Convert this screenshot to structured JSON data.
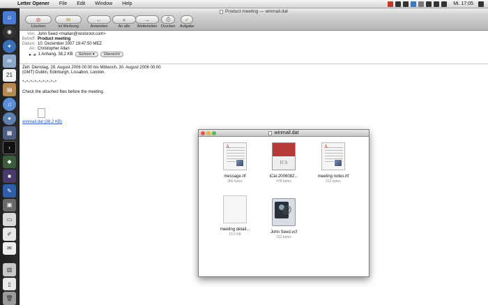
{
  "menubar": {
    "apple": "",
    "app": "Letter Opener",
    "items": [
      "File",
      "Edit",
      "Window",
      "Help"
    ],
    "clock": "Mi. 17:05"
  },
  "mail": {
    "title": "Product meeting — winmail.dat",
    "toolbar": {
      "delete": "Löschen",
      "junk": "Ist Werbung",
      "reply": "Antworten",
      "reply_all": "An alle",
      "forward": "Weiterleiten",
      "print": "Drucken",
      "task": "Aufgabe"
    },
    "headers": {
      "from_label": "Von:",
      "from": "John Seed <mallan@restoroot.com>",
      "subject_label": "Betreff:",
      "subject": "Product meeting",
      "date_label": "Datum:",
      "date": "10. Dezember 2007 19:47:50 MEZ",
      "to_label": "An:",
      "to": "Christopher Allan",
      "attachments": "1 Anhang, 38,2 KB",
      "save_button": "Sichern",
      "overview_button": "Übersicht"
    },
    "body": {
      "line1": "Zeit: Dienstag, 29. August 2006 00:00 bis Mittwoch, 30. August 2006 00:00",
      "line2": "(GMT) Dublin, Edinburgh, Lissabon, London.",
      "line3": "*~*~*~*~*~*~*~*~*",
      "line4": "Check the attached files before the meeting."
    },
    "attachment_link": "winmail.dat (38.2 KB)"
  },
  "finder": {
    "title": "winmail.dat",
    "files": [
      {
        "name": "message.rtf",
        "size": "386 bytes"
      },
      {
        "name": "iCal-2006082...",
        "size": "478 bytes"
      },
      {
        "name": "meeting notes.rtf",
        "size": "231 bytes"
      },
      {
        "name": "meeting detail...",
        "size": "19.0 KB"
      },
      {
        "name": "John Seed.vcf",
        "size": "152 bytes"
      }
    ],
    "ics_label": "ICS"
  }
}
